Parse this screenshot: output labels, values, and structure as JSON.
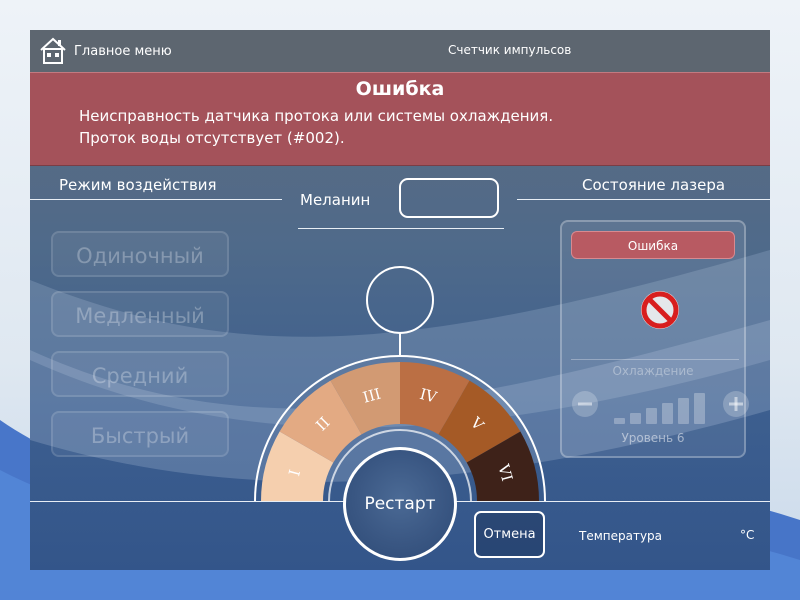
{
  "header": {
    "home_label": "Главное меню",
    "counter_label": "Счетчик импульсов",
    "home_icon": "home-icon"
  },
  "error_banner": {
    "title": "Ошибка",
    "line1": "Неисправность датчика протока или системы охлаждения.",
    "line2": "Проток воды отсутствует (#002)."
  },
  "mode_section": {
    "title": "Режим воздействия",
    "buttons": [
      "Одиночный",
      "Медленный",
      "Средний",
      "Быстрый"
    ]
  },
  "melanin": {
    "label": "Меланин",
    "value": ""
  },
  "skin_types": {
    "labels": [
      "I",
      "II",
      "III",
      "IV",
      "V",
      "VI"
    ],
    "colors": [
      "#f5cfae",
      "#e3aa83",
      "#d29a73",
      "#bb6f44",
      "#a55a26",
      "#3e2219"
    ],
    "selected": null
  },
  "laser_state": {
    "title": "Состояние лазера",
    "status": "Ошибка",
    "status_icon": "no-entry-icon",
    "cooling_label": "Охлаждение",
    "level_label": "Уровень 6",
    "cooling_level": 6,
    "cooling_max": 6
  },
  "bottom": {
    "restart_label": "Рестарт",
    "cancel_label": "Отмена",
    "temperature_label": "Температура",
    "temperature_unit": "°C"
  },
  "colors": {
    "error_red": "#a4525a",
    "accent_white": "#ffffff"
  }
}
